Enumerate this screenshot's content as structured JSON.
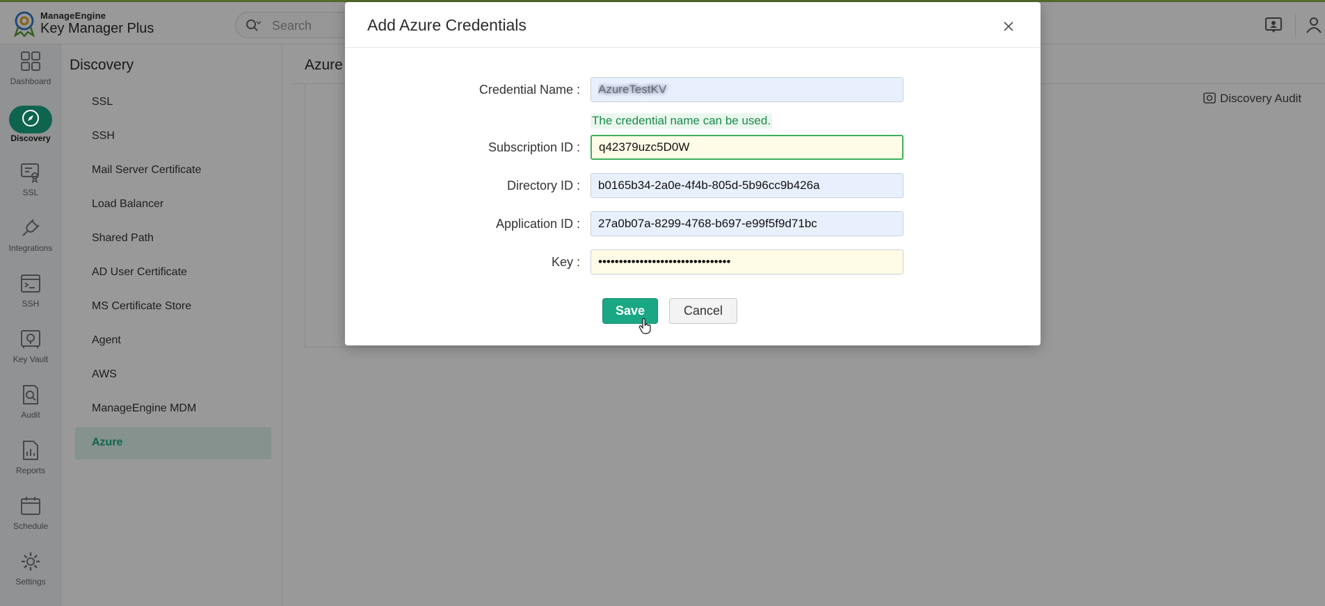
{
  "header": {
    "brand_top": "ManageEngine",
    "brand_main": "Key Manager Plus",
    "search_placeholder": "Search",
    "icons": [
      "logo-icon",
      "search-icon",
      "feedback-icon",
      "user-icon"
    ]
  },
  "leftnav": {
    "items": [
      {
        "label": "Dashboard",
        "icon": "dashboard-icon"
      },
      {
        "label": "Discovery",
        "icon": "compass-icon",
        "active": true
      },
      {
        "label": "SSL",
        "icon": "ssl-certificate-icon"
      },
      {
        "label": "Integrations",
        "icon": "plug-icon"
      },
      {
        "label": "SSH",
        "icon": "ssh-terminal-icon"
      },
      {
        "label": "Key Vault",
        "icon": "key-vault-icon"
      },
      {
        "label": "Audit",
        "icon": "audit-search-icon"
      },
      {
        "label": "Reports",
        "icon": "reports-icon"
      },
      {
        "label": "Schedule",
        "icon": "calendar-icon"
      },
      {
        "label": "Settings",
        "icon": "gear-icon"
      }
    ],
    "active_color": "#1aa784"
  },
  "submenu": {
    "title": "Discovery",
    "items": [
      {
        "label": "SSL"
      },
      {
        "label": "SSH"
      },
      {
        "label": "Mail Server Certificate"
      },
      {
        "label": "Load Balancer"
      },
      {
        "label": "Shared Path"
      },
      {
        "label": "AD User Certificate"
      },
      {
        "label": "MS Certificate Store"
      },
      {
        "label": "Agent"
      },
      {
        "label": "AWS"
      },
      {
        "label": "ManageEngine MDM"
      },
      {
        "label": "Azure",
        "active": true
      }
    ]
  },
  "content": {
    "title": "Azure",
    "audit_label": "Discovery Audit"
  },
  "modal": {
    "title": "Add Azure Credentials",
    "fields": {
      "credential_name": {
        "label": "Credential Name :",
        "value": "AzureTestKV"
      },
      "credential_hint": "The credential name can be used.",
      "subscription_id": {
        "label": "Subscription ID :",
        "value": "q42379uzc5D0W"
      },
      "directory_id": {
        "label": "Directory ID :",
        "value": "b0165b34-2a0e-4f4b-805d-5b96cc9b426a"
      },
      "application_id": {
        "label": "Application ID :",
        "value": "27a0b07a-8299-4768-b697-e99f5f9d71bc"
      },
      "key": {
        "label": "Key :",
        "value": "••••••••••••••••••••••••••••••••"
      }
    },
    "save_label": "Save",
    "cancel_label": "Cancel"
  },
  "colors": {
    "accent": "#1aa784",
    "valid_border": "#3bb05c",
    "autofill_blue": "#e8f0fe",
    "autofill_yellow": "#fefbe6"
  }
}
